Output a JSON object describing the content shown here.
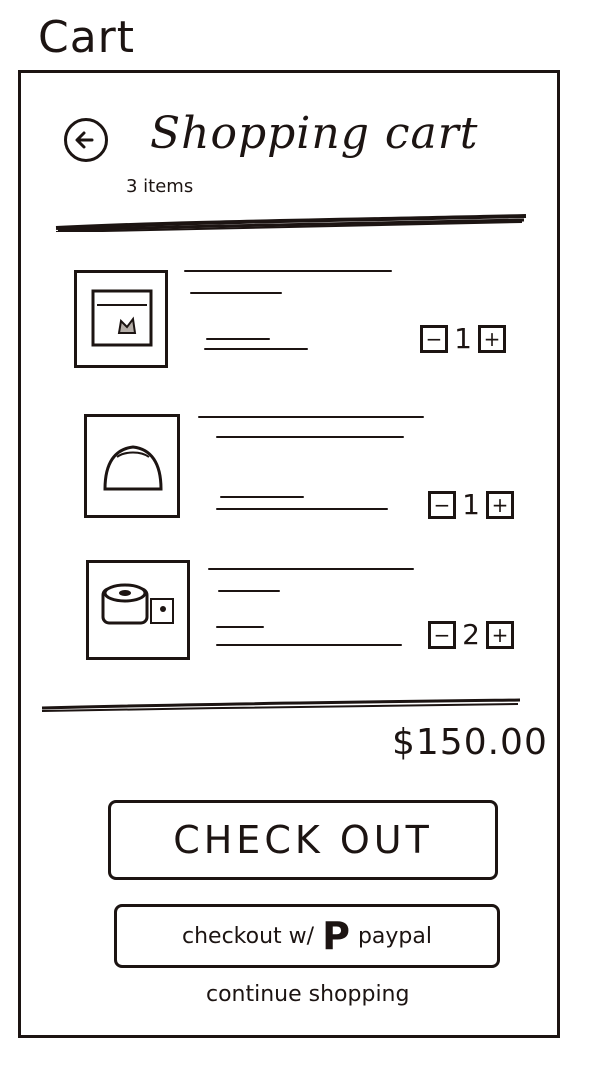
{
  "sketch_label": "Cart",
  "header": {
    "back_icon": "arrow-left-circle-icon",
    "title": "Shopping cart",
    "item_count": "3 items"
  },
  "cart": {
    "items": [
      {
        "thumbnail_icon": "product-image-icon",
        "quantity": "1",
        "decrement_icon": "minus-icon",
        "increment_icon": "plus-icon"
      },
      {
        "thumbnail_icon": "product-image-icon",
        "quantity": "1",
        "decrement_icon": "minus-icon",
        "increment_icon": "plus-icon"
      },
      {
        "thumbnail_icon": "product-image-icon",
        "quantity": "2",
        "decrement_icon": "minus-icon",
        "increment_icon": "plus-icon"
      }
    ]
  },
  "summary": {
    "total": "$150.00"
  },
  "actions": {
    "checkout_label": "CHECK OUT",
    "paypal_prefix": "checkout w/",
    "paypal_logo": "P",
    "paypal_label": "paypal",
    "continue_label": "continue shopping"
  },
  "colors": {
    "ink": "#1c1412",
    "paper": "#ffffff"
  }
}
